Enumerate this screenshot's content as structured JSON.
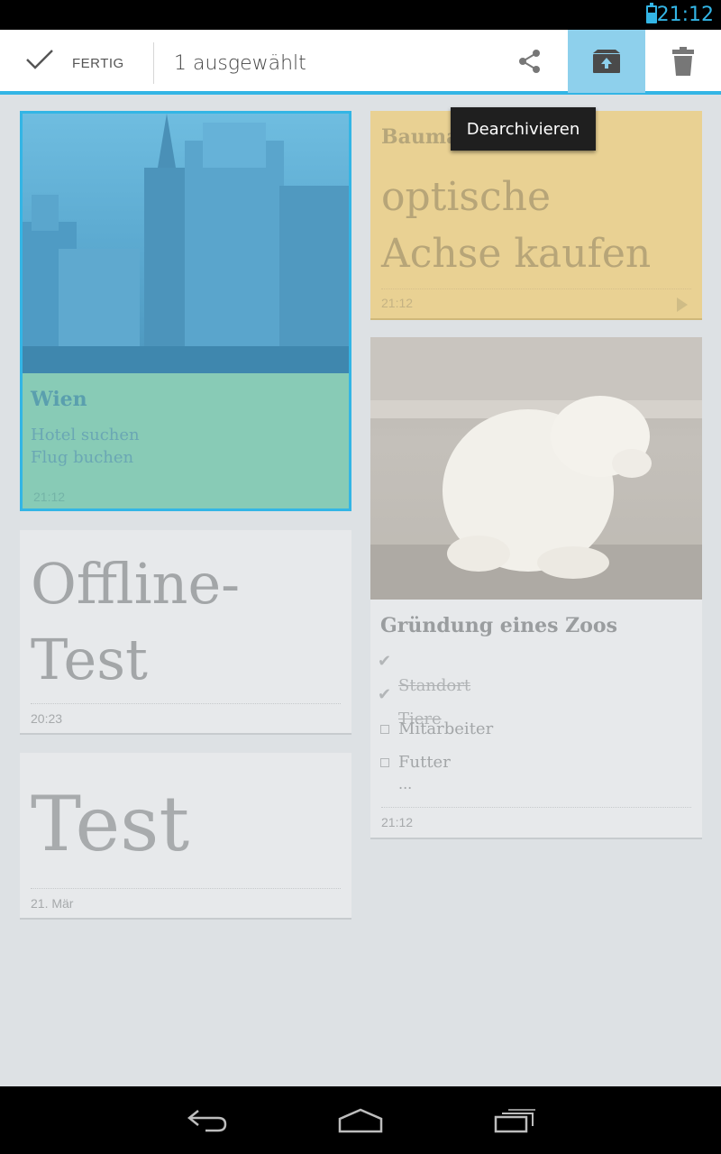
{
  "status_bar": {
    "time": "21:12",
    "battery_level": 0.6,
    "icon": "battery-icon",
    "accent": "#33b5e5"
  },
  "action_bar": {
    "done_label": "FERTIG",
    "selection_count": "1 ausgewählt",
    "icons": [
      "check-icon",
      "share-icon",
      "unarchive-icon",
      "trash-icon"
    ],
    "active_color": "#8ed0ec"
  },
  "tooltip": {
    "text": "Dearchivieren"
  },
  "notes": {
    "wien": {
      "title": "Wien",
      "lines": [
        "Hotel suchen",
        "Flug buchen"
      ],
      "time": "21:12",
      "selected": true,
      "color": "#88cbb6"
    },
    "baumarkt": {
      "title": "Bauma",
      "body_line1": "optische",
      "body_line2": "Achse kaufen",
      "time": "21:12",
      "color": "#e9d193"
    },
    "offline": {
      "body_line1": "Offline-",
      "body_line2": "Test",
      "time": "20:23"
    },
    "test": {
      "body": "Test",
      "time": "21. Mär"
    },
    "zoo": {
      "title": "Gründung eines Zoos",
      "items": [
        {
          "text": "Standort",
          "checked": true
        },
        {
          "text": "Tiere",
          "checked": true
        },
        {
          "text": "Mitarbeiter",
          "checked": false
        },
        {
          "text": "Futter",
          "checked": false
        }
      ],
      "more": "...",
      "time": "21:12"
    }
  },
  "nav_bar": {
    "icons": [
      "back-icon",
      "home-icon",
      "recent-apps-icon"
    ]
  }
}
